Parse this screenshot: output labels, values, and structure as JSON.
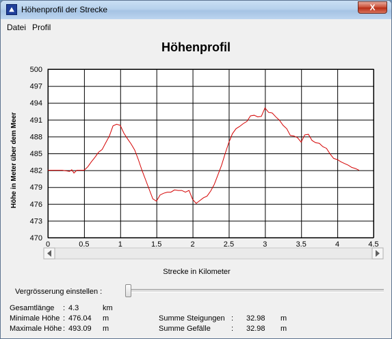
{
  "window": {
    "title": "Höhenprofil der Strecke",
    "close_glyph": "X"
  },
  "menu": [
    {
      "label": "Datei"
    },
    {
      "label": "Profil"
    }
  ],
  "chart_data": {
    "type": "line",
    "title": "Höhenprofil",
    "xlabel": "Strecke in Kilometer",
    "ylabel": "Höhe in Meter über dem Meer",
    "xlim": [
      0,
      4.5
    ],
    "ylim": [
      470,
      500
    ],
    "xticks": [
      0,
      0.5,
      1,
      1.5,
      2,
      2.5,
      3,
      3.5,
      4,
      4.5
    ],
    "xtick_labels": [
      "0",
      "0.5",
      "1",
      "1.5",
      "2",
      "2.5",
      "3",
      "3.5",
      "4",
      "4.5"
    ],
    "yticks": [
      470,
      473,
      476,
      479,
      482,
      485,
      488,
      491,
      494,
      497,
      500
    ],
    "grid": true,
    "line_color": "#d40000",
    "series": [
      {
        "x": [
          0,
          0.2,
          0.3,
          0.33,
          0.36,
          0.4,
          0.5,
          0.55,
          0.6,
          0.65,
          0.7,
          0.75,
          0.8,
          0.85,
          0.9,
          0.95,
          1.0,
          1.05,
          1.1,
          1.15,
          1.2,
          1.25,
          1.3,
          1.35,
          1.4,
          1.45,
          1.5,
          1.55,
          1.6,
          1.65,
          1.7,
          1.75,
          1.8,
          1.85,
          1.9,
          1.95,
          2.0,
          2.05,
          2.1,
          2.15,
          2.2,
          2.25,
          2.3,
          2.35,
          2.4,
          2.45,
          2.5,
          2.55,
          2.6,
          2.65,
          2.7,
          2.75,
          2.8,
          2.85,
          2.9,
          2.95,
          3.0,
          3.05,
          3.1,
          3.15,
          3.2,
          3.25,
          3.3,
          3.35,
          3.4,
          3.45,
          3.5,
          3.55,
          3.6,
          3.65,
          3.7,
          3.75,
          3.8,
          3.85,
          3.9,
          3.95,
          4.0,
          4.05,
          4.1,
          4.15,
          4.2,
          4.25,
          4.3
        ],
        "y": [
          482,
          482,
          481.8,
          482.1,
          481.5,
          482,
          482,
          482.6,
          483.5,
          484.3,
          485.2,
          485.7,
          486.9,
          488.1,
          489.9,
          490.2,
          490,
          488.6,
          487.6,
          486.7,
          485.6,
          483.9,
          482,
          480.3,
          478.6,
          476.9,
          476.5,
          477.6,
          477.9,
          478.1,
          478.1,
          478.5,
          478.4,
          478.4,
          478.1,
          478.4,
          476.8,
          476.1,
          476.6,
          477.1,
          477.4,
          478.3,
          479.5,
          481.2,
          482.9,
          485,
          486.9,
          488.5,
          489.4,
          489.8,
          490.3,
          490.7,
          491.7,
          491.8,
          491.5,
          491.6,
          493.1,
          492.3,
          492.2,
          491.5,
          490.9,
          490,
          489.4,
          488.2,
          488.1,
          487.8,
          487,
          488.3,
          488.4,
          487.3,
          486.9,
          486.8,
          486.2,
          485.9,
          484.9,
          484.1,
          483.9,
          483.5,
          483.2,
          482.9,
          482.5,
          482.3,
          482
        ]
      }
    ]
  },
  "zoom": {
    "label": "Vergrösserung einstellen :",
    "level": 0
  },
  "stats": {
    "length_label": "Gesamtlänge",
    "length_sep": ":",
    "length_value": "4.3",
    "length_unit": "km",
    "min_label": "Minimale Höhe",
    "min_sep": ":",
    "min_value": "476.04",
    "min_unit": "m",
    "max_label": "Maximale Höhe",
    "max_sep": ":",
    "max_value": "493.09",
    "max_unit": "m",
    "ascent_label": "Summe Steigungen",
    "ascent_sep": ":",
    "ascent_value": "32.98",
    "ascent_unit": "m",
    "descent_label": "Summe Gefälle",
    "descent_sep": ":",
    "descent_value": "32.98",
    "descent_unit": "m"
  }
}
